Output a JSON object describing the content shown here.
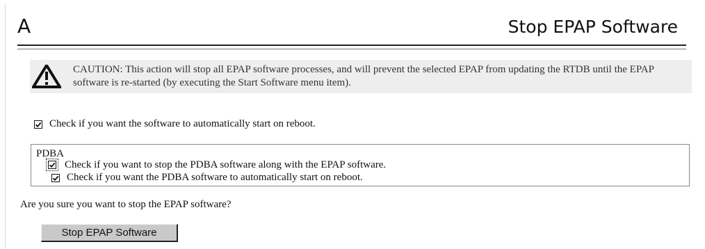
{
  "header": {
    "letter": "A",
    "title": "Stop EPAP Software"
  },
  "caution": {
    "icon": "warning-icon",
    "text": "CAUTION: This action will stop all EPAP software processes, and will prevent the selected EPAP from updating the RTDB until the EPAP software is re-started (by executing the Start Software menu item)."
  },
  "options": {
    "epap_autostart": {
      "checked": true,
      "label": "Check if you want the software to automatically start on reboot."
    }
  },
  "pdba": {
    "title": "PDBA",
    "stop_pdba": {
      "checked": true,
      "label": "Check if you want to stop the PDBA software along with the EPAP software."
    },
    "pdba_autostart": {
      "checked": true,
      "label": "Check if you want the PDBA software to automatically start on reboot."
    }
  },
  "confirm": {
    "question": "Are you sure you want to stop the EPAP software?",
    "button_label": "Stop EPAP Software"
  }
}
